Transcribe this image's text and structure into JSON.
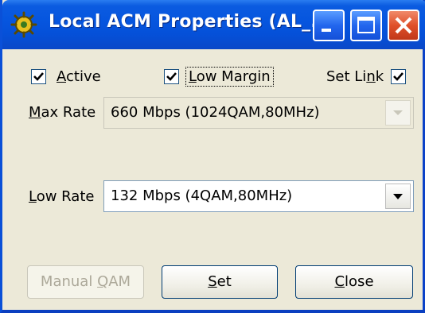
{
  "window": {
    "title": "Local ACM Properties (AL_...",
    "title_icon": "gear-wrench-icon",
    "controls": {
      "minimize": "minimize-icon",
      "maximize": "maximize-icon",
      "close": "close-icon"
    },
    "colors": {
      "titlebar": "#0656df",
      "close_button": "#e0502a",
      "client": "#ece9d8"
    }
  },
  "checkboxes": [
    {
      "prefix": "",
      "mnemonic": "A",
      "suffix": "ctive",
      "checked": true
    },
    {
      "prefix": "",
      "mnemonic": "L",
      "suffix": "ow Margin",
      "checked": true
    },
    {
      "prefix": "Set Li",
      "mnemonic": "n",
      "suffix": "k",
      "checked": true
    }
  ],
  "max_rate": {
    "label_mnemonic": "M",
    "label_rest": "ax Rate",
    "value": "660 Mbps (1024QAM,80MHz)",
    "enabled": false
  },
  "low_rate": {
    "label_mnemonic": "L",
    "label_rest": "ow Rate",
    "value": "132 Mbps (4QAM,80MHz)",
    "enabled": true
  },
  "buttons": {
    "manual_qam": {
      "prefix": "Manual ",
      "mnemonic": "Q",
      "suffix": "AM",
      "enabled": false
    },
    "set": {
      "prefix": "",
      "mnemonic": "S",
      "suffix": "et",
      "enabled": true
    },
    "close": {
      "prefix": "",
      "mnemonic": "C",
      "suffix": "lose",
      "enabled": true
    }
  }
}
